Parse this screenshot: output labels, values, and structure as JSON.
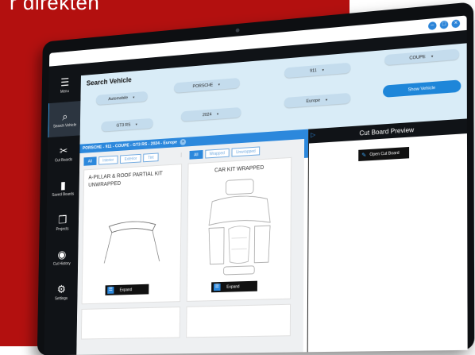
{
  "headline": "r direkten",
  "colors": {
    "brand_red": "#b3100f",
    "accent_blue": "#2c88dc",
    "sidebar_dark": "#101317",
    "panel_light_blue": "#d9ecf7"
  },
  "window_controls": [
    {
      "icon": "minimize-icon",
      "glyph": "–"
    },
    {
      "icon": "maximize-icon",
      "glyph": "□"
    },
    {
      "icon": "close-icon",
      "glyph": "×"
    }
  ],
  "sidebar": {
    "items": [
      {
        "label": "Menu",
        "icon": "menu-icon",
        "glyph": "☰"
      },
      {
        "label": "Search Vehicle",
        "icon": "search-icon",
        "glyph": "⌕"
      },
      {
        "label": "Cut Boards",
        "icon": "cut-board-icon",
        "glyph": "✂"
      },
      {
        "label": "Saved Boards",
        "icon": "bookmark-icon",
        "glyph": "▮"
      },
      {
        "label": "Projects",
        "icon": "projects-icon",
        "glyph": "❐"
      },
      {
        "label": "Cut History",
        "icon": "history-icon",
        "glyph": "◉"
      },
      {
        "label": "Settings",
        "icon": "gear-icon",
        "glyph": "⚙"
      }
    ]
  },
  "search": {
    "title": "Search Vehicle",
    "selects": {
      "category": "Automobile",
      "make": "PORSCHE",
      "model": "911",
      "body": "COUPE",
      "trim": "GT3 RS",
      "year": "2024",
      "region": "Europe"
    },
    "show_button": "Show Vehicle"
  },
  "breadcrumb": {
    "text": "PORSCHE - 911 - COUPE - GT3 RS - 2024 - Europe",
    "close_glyph": "×"
  },
  "filters": {
    "area": [
      "All",
      "Interior",
      "Exterior",
      "Tint"
    ],
    "wrap": [
      "All",
      "Wrapped",
      "Unwrapped"
    ]
  },
  "cards": [
    {
      "title": "A-PILLAR & ROOF PARTIAL KIT UNWRAPPED",
      "expand_label": "Expand"
    },
    {
      "title": "CAR KIT WRAPPED",
      "expand_label": "Expand"
    }
  ],
  "preview": {
    "title": "Cut Board Preview",
    "toggle_glyph": "▷",
    "open_button": "Open Cut Board"
  }
}
